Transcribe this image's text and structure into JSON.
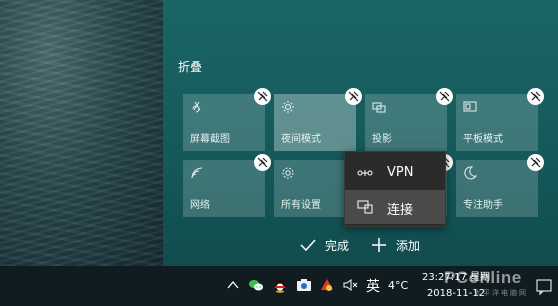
{
  "action_center": {
    "collapse_label": "折叠",
    "tiles_row1": [
      {
        "label": "屏幕截图",
        "icon": "snip-icon",
        "active": false
      },
      {
        "label": "夜间模式",
        "icon": "brightness-icon",
        "active": true
      },
      {
        "label": "投影",
        "icon": "project-icon",
        "active": false
      },
      {
        "label": "平板模式",
        "icon": "tablet-icon",
        "active": false
      }
    ],
    "tiles_row2": [
      {
        "label": "网络",
        "icon": "network-icon",
        "active": false
      },
      {
        "label": "所有设置",
        "icon": "gear-icon",
        "active": false
      },
      {
        "label": "",
        "icon": "",
        "active": false
      },
      {
        "label": "专注助手",
        "icon": "moon-icon",
        "active": false
      }
    ],
    "done_label": "完成",
    "add_label": "添加"
  },
  "context_menu": {
    "items": [
      {
        "label": "VPN",
        "icon": "vpn-icon"
      },
      {
        "label": "连接",
        "icon": "connect-icon"
      }
    ]
  },
  "taskbar": {
    "ime": "英",
    "temperature": "4°C",
    "time": "23:27:17 星期",
    "date": "2018-11-12",
    "watermark": "PConline",
    "watermark_sub": "太平洋电脑网"
  },
  "colors": {
    "panel": "#1a6566",
    "tile": "#4b8485",
    "menu_bg": "#2b2b2b",
    "taskbar": "#101c1f"
  }
}
